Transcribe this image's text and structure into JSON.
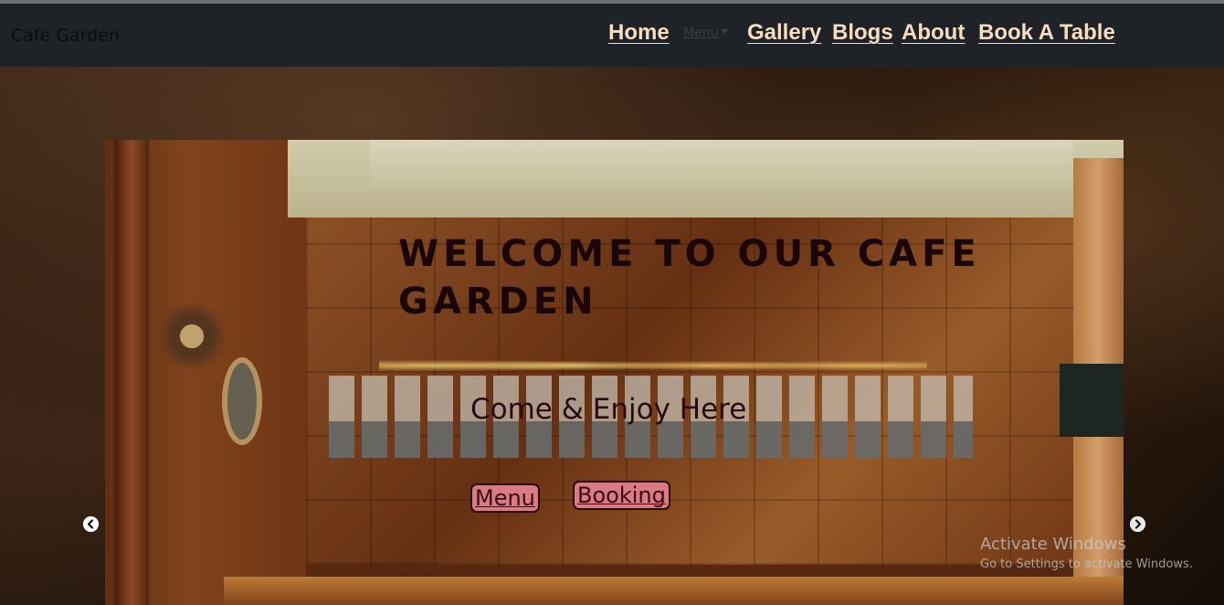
{
  "navbar": {
    "brand": "Cafe Garden",
    "links": {
      "home": "Home",
      "menu_dropdown": "Menu",
      "gallery": "Gallery",
      "blogs": "Blogs",
      "about": "About",
      "book": "Book A Table"
    }
  },
  "carousel": {
    "heading": "WELCOME TO OUR CAFE GARDEN",
    "subheading": "Come & Enjoy Here",
    "buttons": {
      "menu": "Menu",
      "booking": "Booking"
    },
    "prev_icon": "chevron-left-icon",
    "next_icon": "chevron-right-icon"
  },
  "watermark": {
    "title": "Activate Windows",
    "subtitle": "Go to Settings to activate Windows."
  },
  "colors": {
    "navbar_bg": "#1f2226",
    "nav_link": "#f6dcc0",
    "button_bg": "#d97b85",
    "heading_text": "#1a0608"
  }
}
